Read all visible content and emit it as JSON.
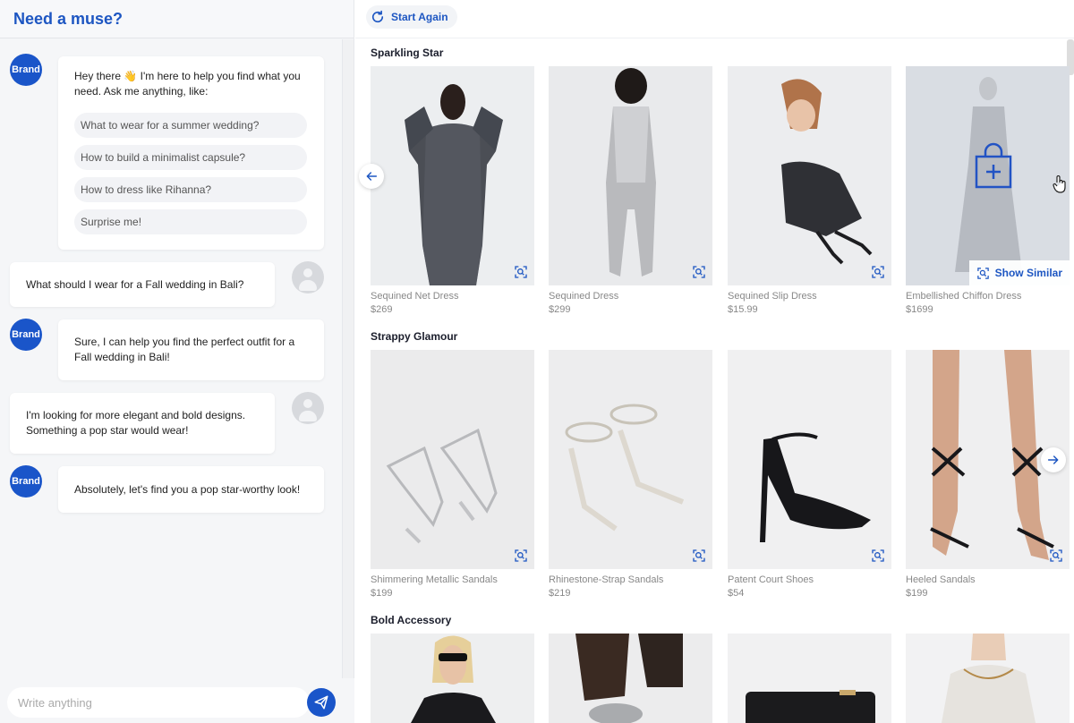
{
  "chat": {
    "title": "Need a muse?",
    "brand_label": "Brand",
    "greeting_line1": "Hey there 👋 I'm here to help you find what you",
    "greeting_line2": "need. Ask me anything, like:",
    "suggestions": [
      "What to wear for a summer wedding?",
      "How to build a minimalist capsule?",
      "How to dress like Rihanna?",
      "Surprise me!"
    ],
    "user_msg_1": "What should I wear for a Fall wedding in Bali?",
    "bot_msg_2_line1": "Sure, I can help you find the perfect outfit for a",
    "bot_msg_2_line2": "Fall wedding in Bali!",
    "user_msg_2_line1": "I'm looking for more elegant and bold designs.",
    "user_msg_2_line2": "Something a pop star would wear!",
    "bot_msg_3": "Absolutely, let's find you a pop star-worthy look!",
    "input_placeholder": "Write anything"
  },
  "toolbar": {
    "start_again": "Start Again"
  },
  "sections": [
    {
      "title": "Sparkling Star",
      "items": [
        {
          "name": "Sequined Net Dress",
          "price": "$269"
        },
        {
          "name": "Sequined Dress",
          "price": "$299"
        },
        {
          "name": "Sequined Slip Dress",
          "price": "$15.99"
        },
        {
          "name": "Embellished Chiffon Dress",
          "price": "$1699"
        }
      ],
      "show_similar": "Show Similar"
    },
    {
      "title": "Strappy Glamour",
      "items": [
        {
          "name": "Shimmering Metallic Sandals",
          "price": "$199"
        },
        {
          "name": "Rhinestone-Strap Sandals",
          "price": "$219"
        },
        {
          "name": "Patent Court Shoes",
          "price": "$54"
        },
        {
          "name": "Heeled Sandals",
          "price": "$199"
        }
      ]
    },
    {
      "title": "Bold Accessory"
    }
  ],
  "colors": {
    "accent": "#1a55c9",
    "panel_bg": "#f5f6f8"
  }
}
